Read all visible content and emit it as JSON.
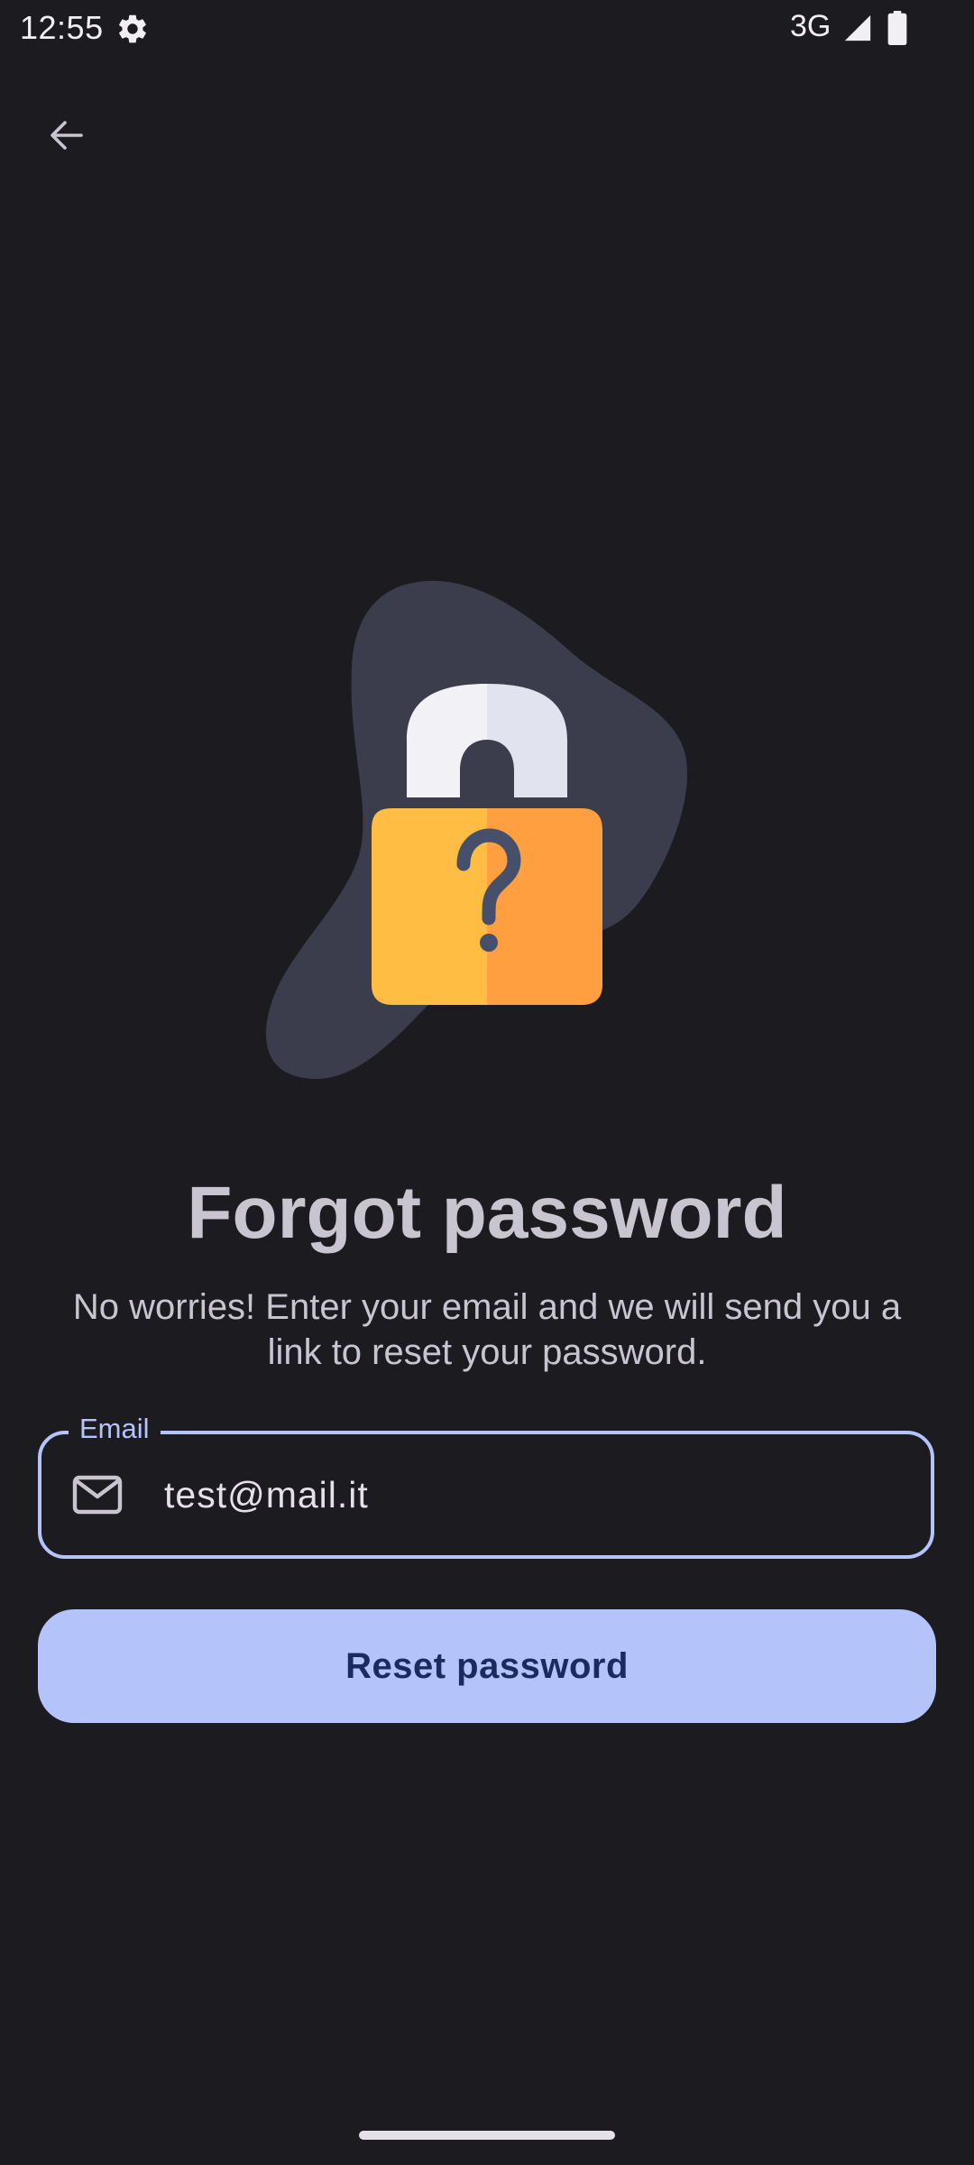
{
  "status_bar": {
    "time": "12:55",
    "network": "3G",
    "icons": [
      "gear-icon",
      "signal-icon",
      "battery-icon"
    ]
  },
  "app_bar": {
    "back_icon": "arrow-left-icon"
  },
  "illustration": {
    "icon": "padlock-question-icon",
    "colors": {
      "blob": "#3b3d4c",
      "shackle_light": "#f2f2f6",
      "shackle_shade": "#e1e3ee",
      "body_left": "#ffbd44",
      "body_right": "#ff9f40",
      "question_mark": "#46506a"
    }
  },
  "content": {
    "title": "Forgot password",
    "subtitle": "No worries! Enter your email and we will send you a link to reset your password."
  },
  "form": {
    "email": {
      "label": "Email",
      "value": "test@mail.it",
      "icon": "mail-icon"
    },
    "submit_label": "Reset password"
  },
  "colors": {
    "background": "#1c1b20",
    "accent": "#b4c4fb",
    "button_text": "#1b2a60",
    "text": "#c8c5d0"
  }
}
